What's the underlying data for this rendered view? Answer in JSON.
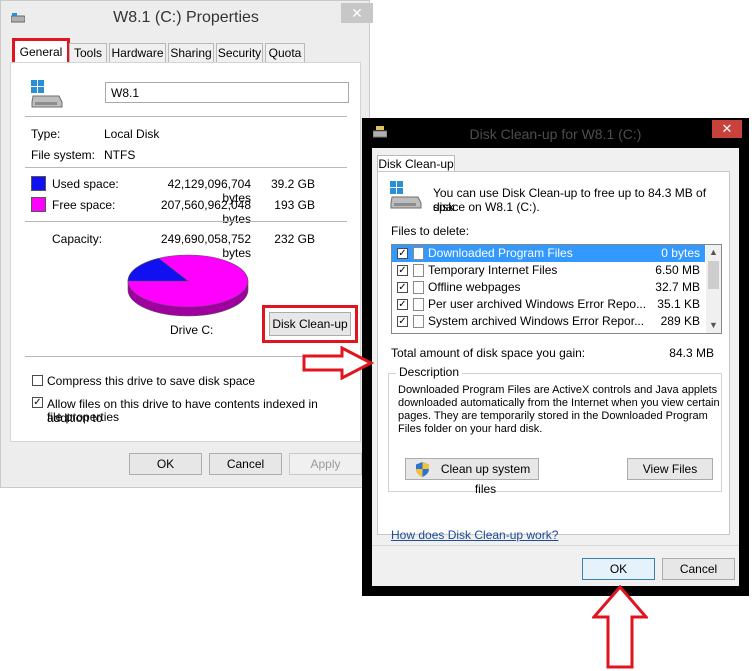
{
  "properties": {
    "title": "W8.1 (C:) Properties",
    "close_glyph": "✕",
    "tabs": [
      "General",
      "Tools",
      "Hardware",
      "Sharing",
      "Security",
      "Quota"
    ],
    "drive_name": "W8.1",
    "type_label": "Type:",
    "type_value": "Local Disk",
    "fs_label": "File system:",
    "fs_value": "NTFS",
    "used_label": "Used space:",
    "used_bytes": "42,129,096,704 bytes",
    "used_size": "39.2 GB",
    "free_label": "Free space:",
    "free_bytes": "207,560,962,048 bytes",
    "free_size": "193 GB",
    "capacity_label": "Capacity:",
    "capacity_bytes": "249,690,058,752 bytes",
    "capacity_size": "232 GB",
    "drive_caption": "Drive C:",
    "cleanup_button": "Disk Clean-up",
    "compress_label": "Compress this drive to save disk space",
    "compress_checked": false,
    "index_label_line1": "Allow files on this drive to have contents indexed in addition to",
    "index_label_line2": "file properties",
    "index_checked": true,
    "ok": "OK",
    "cancel": "Cancel",
    "apply": "Apply",
    "used_fraction": 0.169,
    "colors": {
      "used": "#1010f0",
      "free": "#ff00ff",
      "highlight": "#e0151f"
    }
  },
  "cleanup": {
    "title": "Disk Clean-up for W8.1 (C:)",
    "close_glyph": "✕",
    "tab": "Disk Clean-up",
    "intro_line1": "You can use Disk Clean-up to free up to 84.3 MB of disk",
    "intro_line2": "space on W8.1 (C:).",
    "files_label": "Files to delete:",
    "files": [
      {
        "name": "Downloaded Program Files",
        "size": "0 bytes",
        "checked": true,
        "selected": true
      },
      {
        "name": "Temporary Internet Files",
        "size": "6.50 MB",
        "checked": true,
        "selected": false
      },
      {
        "name": "Offline webpages",
        "size": "32.7 MB",
        "checked": true,
        "selected": false
      },
      {
        "name": "Per user archived Windows Error Repo...",
        "size": "35.1 KB",
        "checked": true,
        "selected": false
      },
      {
        "name": "System archived Windows Error Repor...",
        "size": "289 KB",
        "checked": true,
        "selected": false
      }
    ],
    "total_label": "Total amount of disk space you gain:",
    "total_value": "84.3 MB",
    "description_label": "Description",
    "description_lines": [
      "Downloaded Program Files are ActiveX controls and Java applets",
      "downloaded automatically from the Internet when you view certain",
      "pages. They are temporarily stored in the Downloaded Program",
      "Files folder on your hard disk."
    ],
    "system_files_button": "Clean up system files",
    "view_files_button": "View Files",
    "help_link": "How does Disk Clean-up work?",
    "ok": "OK",
    "cancel": "Cancel"
  }
}
